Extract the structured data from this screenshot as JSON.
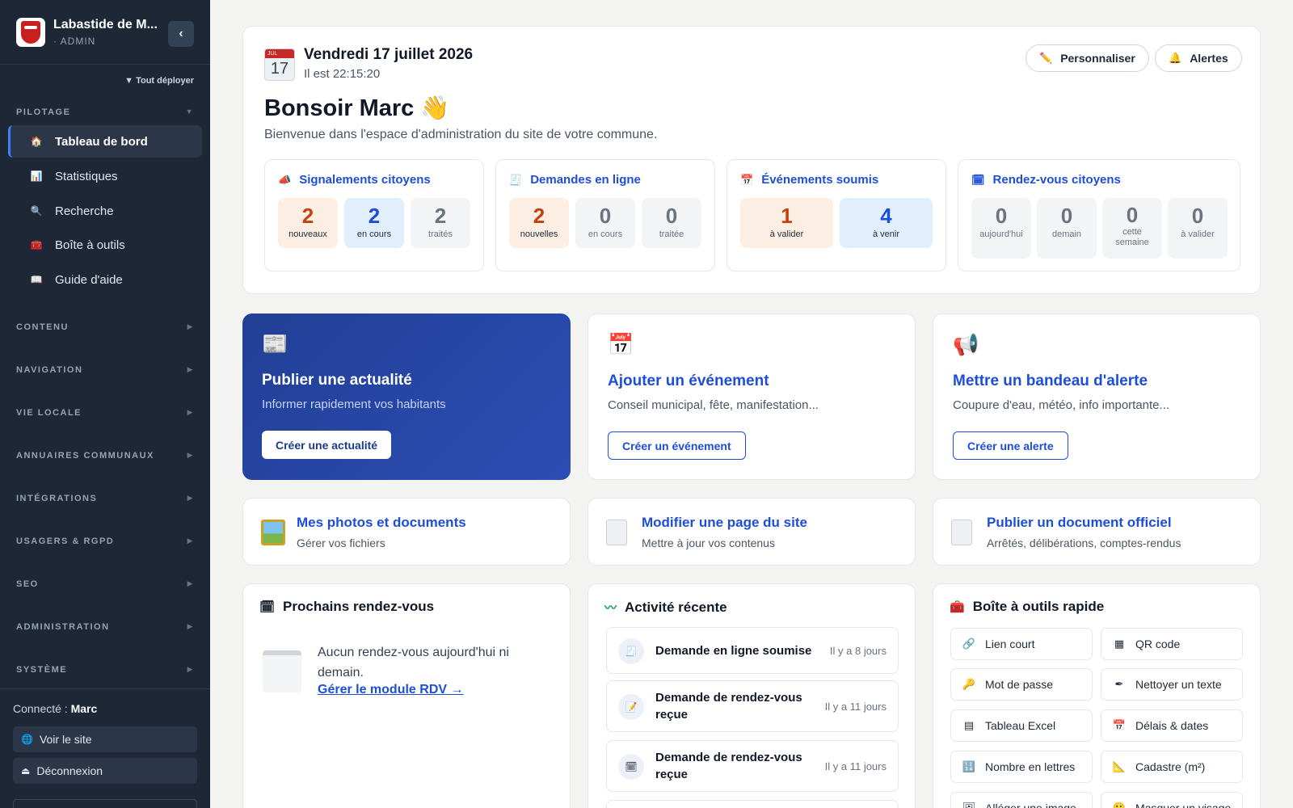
{
  "sidebar": {
    "brand_name": "Labastide de M...",
    "brand_role": "· ADMIN",
    "expand_all": "▼ Tout déployer",
    "group_pilotage": "PILOTAGE",
    "nav": [
      {
        "label": "Tableau de bord",
        "icon": "🏠"
      },
      {
        "label": "Statistiques",
        "icon": "📊"
      },
      {
        "label": "Recherche",
        "icon": "🔍"
      },
      {
        "label": "Boîte à outils",
        "icon": "🧰"
      },
      {
        "label": "Guide d'aide",
        "icon": "📖"
      }
    ],
    "groups": [
      "CONTENU",
      "NAVIGATION",
      "VIE LOCALE",
      "ANNUAIRES COMMUNAUX",
      "INTÉGRATIONS",
      "USAGERS & RGPD",
      "SEO",
      "ADMINISTRATION",
      "SYSTÈME"
    ],
    "connected_prefix": "Connecté : ",
    "connected_user": "Marc",
    "view_site": "Voir le site",
    "logout": "Déconnexion"
  },
  "header": {
    "cal_month": "JUL",
    "cal_day": "17",
    "date": "Vendredi 17 juillet 2026",
    "time": "Il est 22:15:20",
    "customize": "Personnaliser",
    "alerts": "Alertes",
    "greeting": "Bonsoir Marc 👋",
    "welcome": "Bienvenue dans l'espace d'administration du site de votre commune."
  },
  "stats": [
    {
      "title": "Signalements citoyens",
      "icon": "📣",
      "tiles": [
        {
          "n": "2",
          "l": "nouveaux"
        },
        {
          "n": "2",
          "l": "en cours"
        },
        {
          "n": "2",
          "l": "traités"
        }
      ]
    },
    {
      "title": "Demandes en ligne",
      "icon": "🧾",
      "tiles": [
        {
          "n": "2",
          "l": "nouvelles"
        },
        {
          "n": "0",
          "l": "en cours"
        },
        {
          "n": "0",
          "l": "traitée"
        }
      ]
    },
    {
      "title": "Événements soumis",
      "icon": "📅",
      "tiles": [
        {
          "n": "1",
          "l": "à valider"
        },
        {
          "n": "4",
          "l": "à venir"
        }
      ]
    },
    {
      "title": "Rendez-vous citoyens",
      "icon": "🗓",
      "tiles": [
        {
          "n": "0",
          "l": "aujourd'hui"
        },
        {
          "n": "0",
          "l": "demain"
        },
        {
          "n": "0",
          "l": "cette semaine"
        },
        {
          "n": "0",
          "l": "à valider"
        }
      ]
    }
  ],
  "actions": [
    {
      "icon": "📰",
      "title": "Publier une actualité",
      "sub": "Informer rapidement vos habitants",
      "button": "Créer une actualité"
    },
    {
      "icon": "📅",
      "title": "Ajouter un événement",
      "sub": "Conseil municipal, fête, manifestation...",
      "button": "Créer un événement"
    },
    {
      "icon": "📢",
      "title": "Mettre un bandeau d'alerte",
      "sub": "Coupure d'eau, météo, info importante...",
      "button": "Créer une alerte"
    }
  ],
  "shortcuts": [
    {
      "title": "Mes photos et documents",
      "sub": "Gérer vos fichiers"
    },
    {
      "title": "Modifier une page du site",
      "sub": "Mettre à jour vos contenus"
    },
    {
      "title": "Publier un document officiel",
      "sub": "Arrêtés, délibérations, comptes-rendus"
    }
  ],
  "rdv": {
    "title": "Prochains rendez-vous",
    "text": "Aucun rendez-vous aujourd'hui ni demain.",
    "link": "Gérer le module RDV →"
  },
  "activity": {
    "title": "Activité récente",
    "items": [
      {
        "label": "Demande en ligne soumise",
        "time": "Il y a 8 jours",
        "icon": "🧾"
      },
      {
        "label": "Demande de rendez-vous reçue",
        "time": "Il y a 11 jours",
        "icon": "📝"
      },
      {
        "label": "Demande de rendez-vous reçue",
        "time": "Il y a 11 jours",
        "icon": "🗓"
      }
    ]
  },
  "tools": {
    "title": "Boîte à outils rapide",
    "items": [
      {
        "label": "Lien court",
        "icon": "🔗"
      },
      {
        "label": "QR code",
        "icon": "▦"
      },
      {
        "label": "Mot de passe",
        "icon": "🔑"
      },
      {
        "label": "Nettoyer un texte",
        "icon": "✒"
      },
      {
        "label": "Tableau Excel",
        "icon": "▤"
      },
      {
        "label": "Délais & dates",
        "icon": "📅"
      },
      {
        "label": "Nombre en lettres",
        "icon": "🔢"
      },
      {
        "label": "Cadastre (m²)",
        "icon": "📐"
      },
      {
        "label": "Alléger une image",
        "icon": "🖼"
      },
      {
        "label": "Masquer un visage",
        "icon": "🙂"
      }
    ]
  }
}
